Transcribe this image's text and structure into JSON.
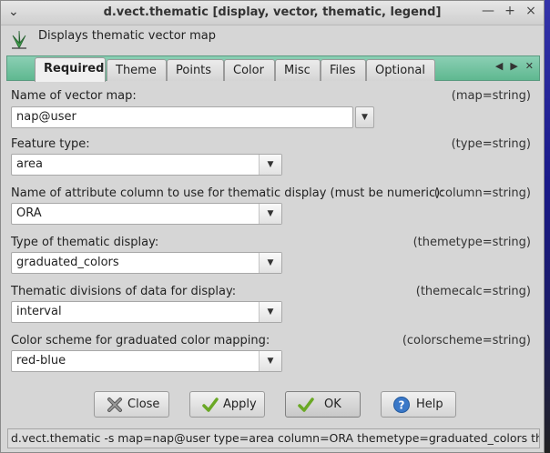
{
  "window": {
    "title": "d.vect.thematic [display, vector, thematic, legend]",
    "menu_icon": "chevron-down-icon",
    "controls": [
      "—",
      "+",
      "×"
    ]
  },
  "header": {
    "description": "Displays thematic vector map"
  },
  "tabs": [
    "Required",
    "Theme",
    "Points",
    "Color",
    "Misc",
    "Files",
    "Optional"
  ],
  "active_tab": "Required",
  "fields": {
    "map": {
      "label": "Name of vector map:",
      "hint": "(map=string)",
      "value": "nap@user"
    },
    "type": {
      "label": "Feature type:",
      "hint": "(type=string)",
      "value": "area"
    },
    "column": {
      "label": "Name of attribute column to use for thematic display (must be numeric):",
      "hint": "(column=string)",
      "value": "ORA"
    },
    "themetype": {
      "label": "Type of thematic display:",
      "hint": "(themetype=string)",
      "value": "graduated_colors"
    },
    "themecalc": {
      "label": "Thematic divisions of data for display:",
      "hint": "(themecalc=string)",
      "value": "interval"
    },
    "colorscheme": {
      "label": "Color scheme for graduated color mapping:",
      "hint": "(colorscheme=string)",
      "value": "red-blue"
    }
  },
  "buttons": {
    "close": "Close",
    "apply": "Apply",
    "ok": "OK",
    "help": "Help"
  },
  "status": {
    "command": "d.vect.thematic -s map=nap@user type=area column=ORA themetype=graduated_colors themeca"
  },
  "colors": {
    "tab_strip": "#6cc19c",
    "window_bg": "#d6d6d6"
  }
}
